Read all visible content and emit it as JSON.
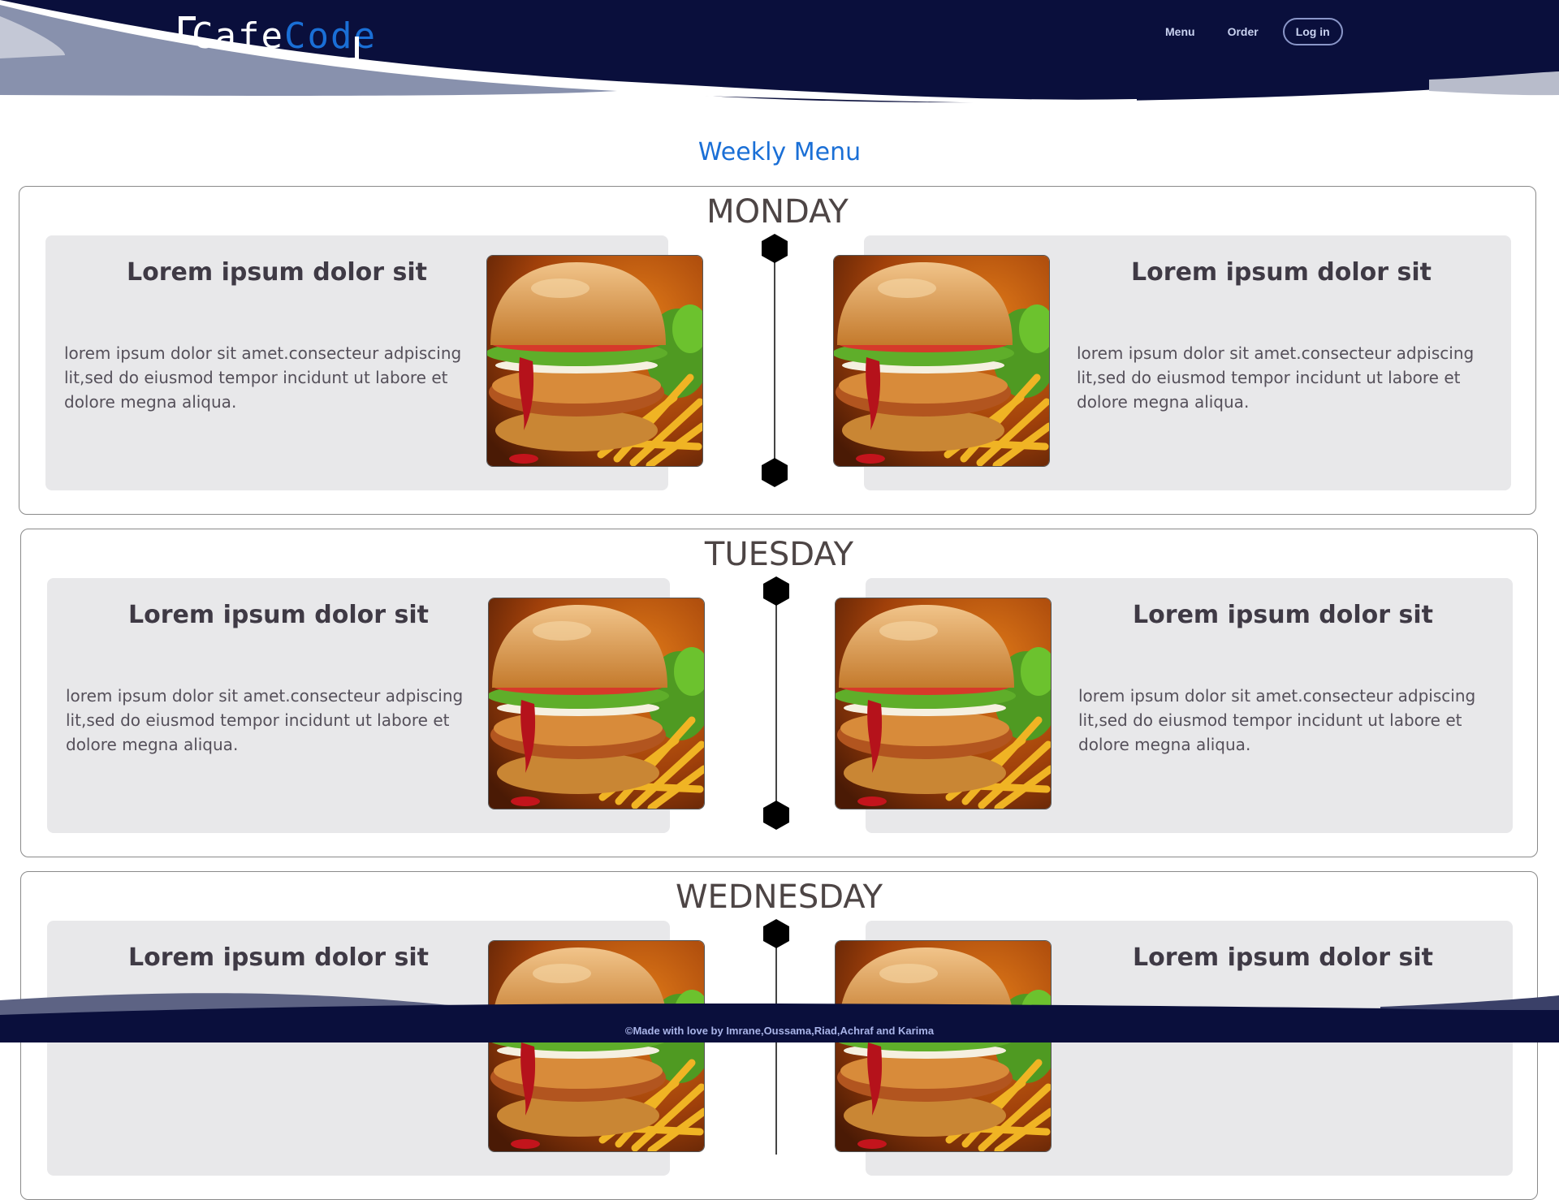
{
  "header": {
    "logo": {
      "part1": "Cafe",
      "part2": "Code"
    },
    "nav": {
      "menu": "Menu",
      "order": "Order",
      "login": "Log in"
    }
  },
  "page": {
    "title": "Weekly Menu"
  },
  "days": [
    {
      "name": "MONDAY",
      "left": {
        "title": "Lorem ipsum dolor sit",
        "text": "lorem ipsum dolor sit amet.consecteur adpiscing lit,sed do eiusmod tempor incidunt ut labore et dolore megna aliqua."
      },
      "right": {
        "title": "Lorem ipsum dolor sit",
        "text": "lorem ipsum dolor sit amet.consecteur adpiscing lit,sed do eiusmod tempor incidunt ut labore et dolore megna aliqua."
      }
    },
    {
      "name": "TUESDAY",
      "left": {
        "title": "Lorem ipsum dolor sit",
        "text": "lorem ipsum dolor sit amet.consecteur adpiscing lit,sed do eiusmod tempor incidunt ut labore et dolore megna aliqua."
      },
      "right": {
        "title": "Lorem ipsum dolor sit",
        "text": "lorem ipsum dolor sit amet.consecteur adpiscing lit,sed do eiusmod tempor incidunt ut labore et dolore megna aliqua."
      }
    },
    {
      "name": "WEDNESDAY",
      "left": {
        "title": "Lorem ipsum dolor sit",
        "text": ""
      },
      "right": {
        "title": "Lorem ipsum dolor sit",
        "text": ""
      }
    }
  ],
  "footer": {
    "text": "©Made with love by  Imrane,Oussama,Riad,Achraf and Karima"
  },
  "colors": {
    "navy": "#0a0f3c",
    "accent": "#1a6fd6",
    "card": "#e8e8ea",
    "dayText": "#4d4545"
  }
}
